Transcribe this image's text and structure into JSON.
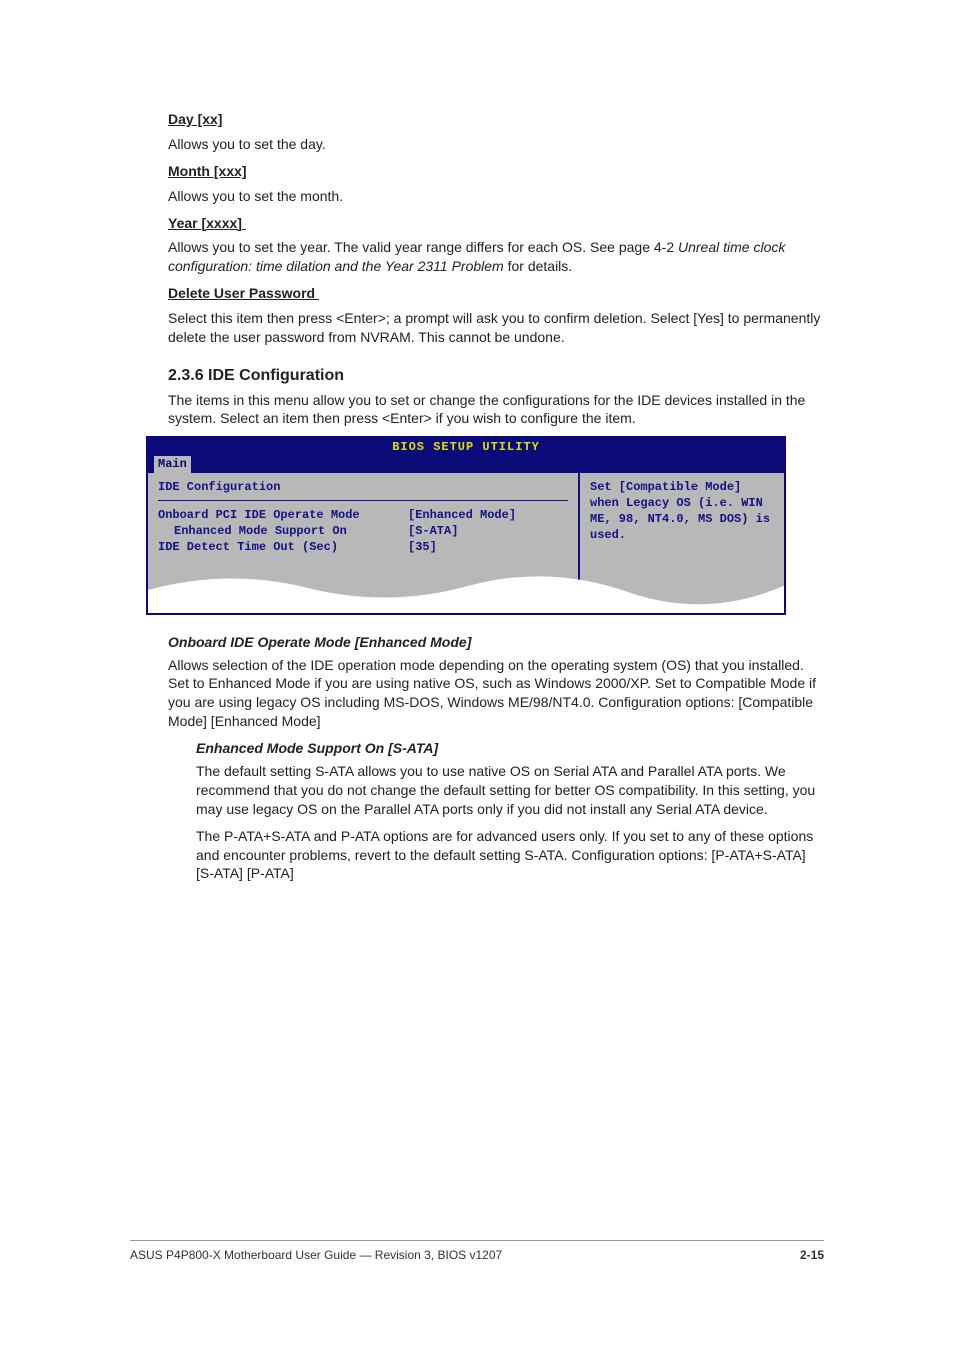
{
  "sections": {
    "day": {
      "title": "Day [xx]",
      "body": "Allows you to set the day."
    },
    "month": {
      "title": "Month [xxx]",
      "body": "Allows you to set the month."
    },
    "year": {
      "title": "Year [xxxx]",
      "body_prefix": "Allows you to set the year. The valid year range differs for each OS. See page 4-2 ",
      "body_italic": "Unreal time clock configuration: time dilation and the Year 2311 Problem",
      "body_suffix": " for details."
    },
    "delete_pw": {
      "title": "Delete User Password",
      "body": "Select this item then press <Enter>; a prompt will ask you to confirm deletion. Select [Yes] to permanently delete the user password from NVRAM. This cannot be undone."
    },
    "ide_config": {
      "title": "2.3.6  IDE Configuration",
      "body": "The items in this menu allow you to set or change the configurations for the IDE devices installed in the system. Select an item then press <Enter> if you wish to configure the item."
    }
  },
  "bios": {
    "title": "BIOS SETUP UTILITY",
    "tab": "Main",
    "config_title": "IDE Configuration",
    "rows": [
      {
        "label": "Onboard PCI IDE Operate Mode",
        "value": "[Enhanced Mode]"
      },
      {
        "label": "Enhanced Mode Support On",
        "value": "[S-ATA]",
        "indent": true
      },
      {
        "label": "IDE Detect Time Out (Sec)",
        "value": "[35]"
      }
    ],
    "help": "Set [Compatible Mode] when Legacy OS (i.e. WIN ME, 98, NT4.0, MS DOS) is used."
  },
  "pci_ide": {
    "title": "Onboard IDE Operate Mode [Enhanced Mode]",
    "body": "Allows selection of the IDE operation mode depending on the operating system (OS) that you installed. Set to Enhanced Mode if you are using native OS, such as Windows 2000/XP. Set to Compatible Mode if you are using legacy OS including MS-DOS, Windows ME/98/NT4.0. Configuration options: [Compatible Mode] [Enhanced Mode]"
  },
  "enh_support": {
    "title": "Enhanced Mode Support On [S-ATA]",
    "body1": "The default setting S-ATA allows you to use native OS on Serial ATA and Parallel ATA ports. We recommend that you do not change the default setting for better OS compatibility. In this setting, you may use legacy OS on the Parallel ATA ports only if you did not install any Serial ATA device.",
    "body2": "The P-ATA+S-ATA and P-ATA options are for advanced users only. If you set to any of these options and encounter problems, revert to the default setting S-ATA. Configuration options: [P-ATA+S-ATA] [S-ATA] [P-ATA]"
  },
  "footer": {
    "manual": "ASUS P4P800-X Motherboard User Guide — Revision 3, BIOS v1207",
    "page": "2-15"
  }
}
